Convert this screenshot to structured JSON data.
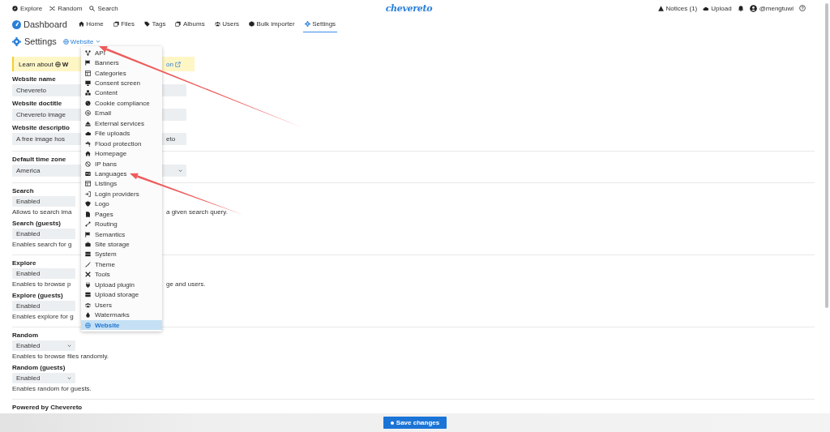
{
  "topbar": {
    "left": [
      "Explore",
      "Random",
      "Search"
    ],
    "logo": "chevereto",
    "right": [
      "Notices (1)",
      "Upload",
      "@mengtuwi"
    ]
  },
  "nav": {
    "brand": "Dashboard",
    "tabs": [
      {
        "label": "Home",
        "selected": false
      },
      {
        "label": "Files",
        "selected": false
      },
      {
        "label": "Tags",
        "selected": false
      },
      {
        "label": "Albums",
        "selected": false
      },
      {
        "label": "Users",
        "selected": false
      },
      {
        "label": "Bulk importer",
        "selected": false
      },
      {
        "label": "Settings",
        "selected": true
      }
    ]
  },
  "heading": {
    "title": "Settings",
    "switcher": "Website"
  },
  "notice": {
    "lead": "Learn about",
    "bold": "W",
    "tail": "on"
  },
  "sections": [
    {
      "fields": [
        {
          "label": "Website name",
          "kind": "input",
          "value": [
            "Chevereto"
          ]
        },
        {
          "label": "Website doctitle",
          "kind": "input",
          "value": [
            "Chevereto image"
          ]
        },
        {
          "label": "Website descriptio",
          "kind": "input",
          "value": [
            "A free image hos",
            "eto"
          ]
        }
      ]
    },
    {
      "fields": [
        {
          "label": "Default time zone",
          "kind": "select",
          "wide": true,
          "caret": true,
          "value": [
            "America"
          ]
        }
      ]
    },
    {
      "fields": [
        {
          "label": "Search",
          "kind": "select",
          "wide": false,
          "caret": false,
          "value": [
            "Enabled"
          ],
          "hint": [
            "Allows to search ima",
            "a given search query."
          ]
        },
        {
          "label": "Search (guests)",
          "kind": "select",
          "wide": false,
          "caret": false,
          "value": [
            "Enabled"
          ],
          "hint": [
            "Enables search for g"
          ]
        }
      ]
    },
    {
      "fields": [
        {
          "label": "Explore",
          "kind": "select",
          "wide": false,
          "caret": false,
          "value": [
            "Enabled"
          ],
          "hint": [
            "Enables to browse p",
            "ge and users."
          ]
        },
        {
          "label": "Explore (guests)",
          "kind": "select",
          "wide": false,
          "caret": false,
          "value": [
            "Enabled"
          ],
          "hint": [
            "Enables explore for g"
          ]
        }
      ]
    },
    {
      "fields": [
        {
          "label": "Random",
          "kind": "select",
          "wide": false,
          "caret": true,
          "value": [
            "Enabled"
          ],
          "hint": [
            "Enables to browse files randomly."
          ]
        },
        {
          "label": "Random (guests)",
          "kind": "select",
          "wide": false,
          "caret": true,
          "value": [
            "Enabled"
          ],
          "hint": [
            "Enables random for guests."
          ]
        }
      ]
    },
    {
      "fields": [
        {
          "label": "Powered by Chevereto"
        }
      ]
    }
  ],
  "menu": {
    "items": [
      {
        "label": "API",
        "selected": false
      },
      {
        "label": "Banners",
        "selected": false
      },
      {
        "label": "Categories",
        "selected": false
      },
      {
        "label": "Consent screen",
        "selected": false
      },
      {
        "label": "Content",
        "selected": false
      },
      {
        "label": "Cookie compliance",
        "selected": false
      },
      {
        "label": "Email",
        "selected": false
      },
      {
        "label": "External services",
        "selected": false
      },
      {
        "label": "File uploads",
        "selected": false
      },
      {
        "label": "Flood protection",
        "selected": false
      },
      {
        "label": "Homepage",
        "selected": false
      },
      {
        "label": "IP bans",
        "selected": false
      },
      {
        "label": "Languages",
        "selected": false
      },
      {
        "label": "Listings",
        "selected": false
      },
      {
        "label": "Login providers",
        "selected": false
      },
      {
        "label": "Logo",
        "selected": false
      },
      {
        "label": "Pages",
        "selected": false
      },
      {
        "label": "Routing",
        "selected": false
      },
      {
        "label": "Semantics",
        "selected": false
      },
      {
        "label": "Site storage",
        "selected": false
      },
      {
        "label": "System",
        "selected": false
      },
      {
        "label": "Theme",
        "selected": false
      },
      {
        "label": "Tools",
        "selected": false
      },
      {
        "label": "Upload plugin",
        "selected": false
      },
      {
        "label": "Upload storage",
        "selected": false
      },
      {
        "label": "Users",
        "selected": false
      },
      {
        "label": "Watermarks",
        "selected": false
      },
      {
        "label": "Website",
        "selected": true
      }
    ]
  },
  "footer": {
    "save": "Save changes"
  },
  "annotations": [
    {
      "kind": "arrow"
    },
    {
      "kind": "arrow"
    }
  ]
}
